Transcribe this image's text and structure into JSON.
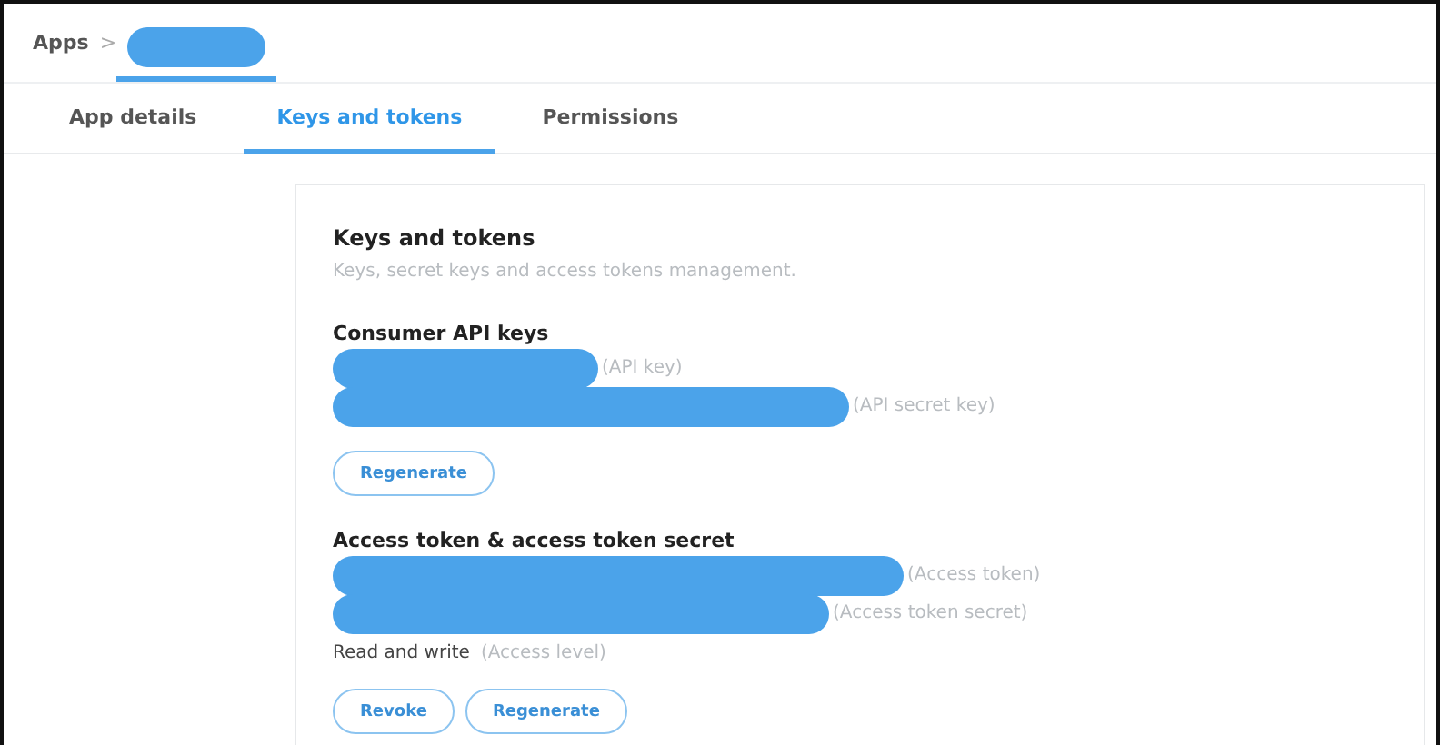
{
  "breadcrumb": {
    "root": "Apps",
    "separator": ">"
  },
  "tabs": [
    {
      "label": "App details",
      "selected": false
    },
    {
      "label": "Keys and tokens",
      "selected": true
    },
    {
      "label": "Permissions",
      "selected": false
    }
  ],
  "section": {
    "title": "Keys and tokens",
    "description": "Keys, secret keys and access tokens management."
  },
  "groups": [
    {
      "title": "Consumer API keys",
      "keys": [
        {
          "label": "(API key)"
        },
        {
          "label": "(API secret key)"
        }
      ],
      "buttons": [
        "Regenerate"
      ]
    },
    {
      "title": "Access token & access token secret",
      "keys": [
        {
          "label": "(Access token)"
        },
        {
          "label": "(Access token secret)"
        }
      ],
      "access": {
        "value": "Read and write",
        "label": "(Access level)"
      },
      "buttons": [
        "Revoke",
        "Regenerate"
      ]
    }
  ]
}
